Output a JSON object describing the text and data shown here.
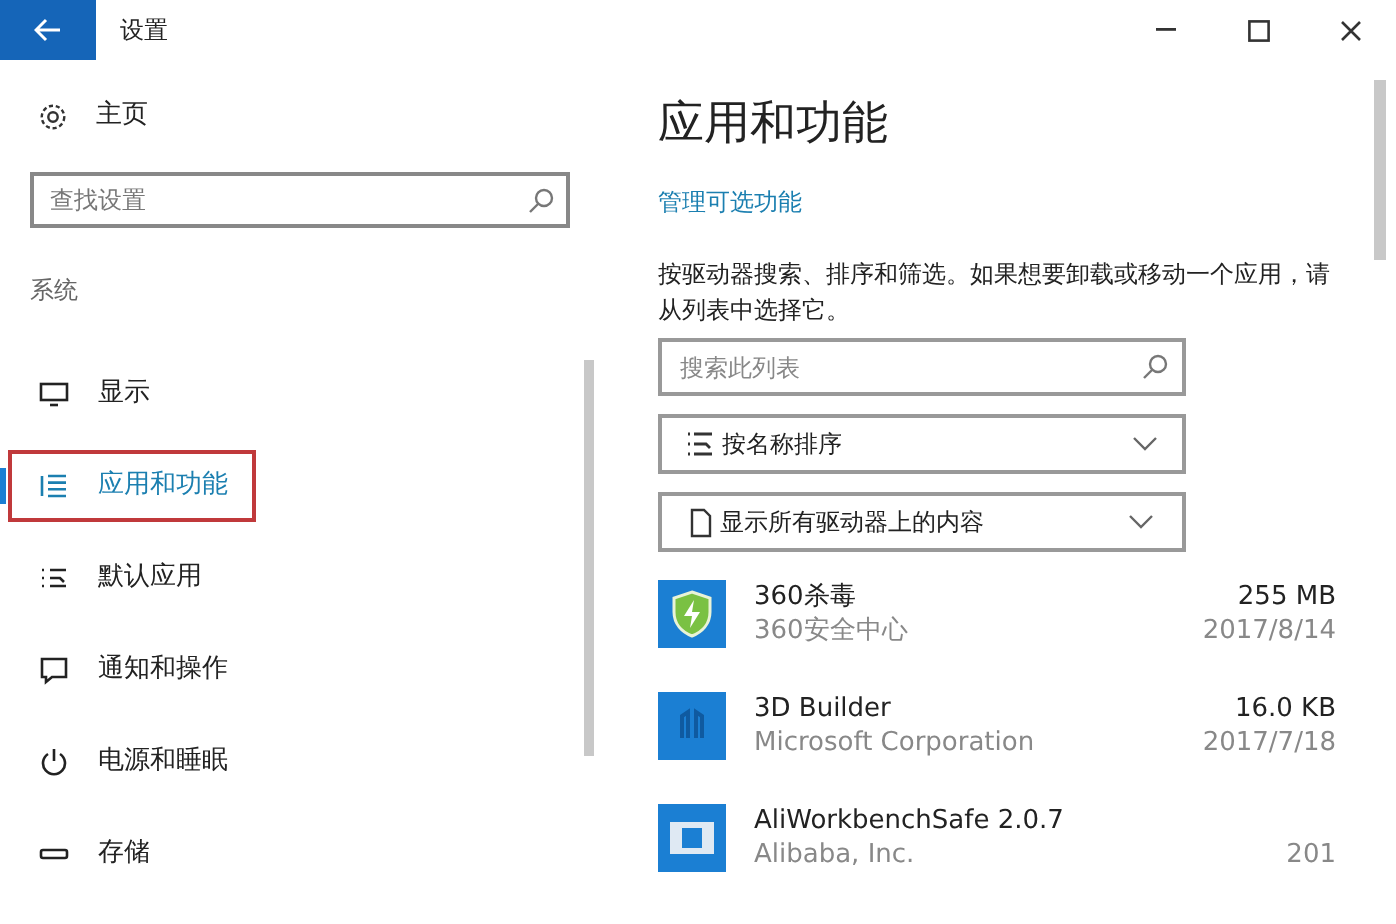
{
  "window": {
    "title": "设置"
  },
  "sidebar": {
    "home": "主页",
    "search": {
      "placeholder": "查找设置"
    },
    "section": "系统",
    "items": [
      {
        "label": "显示",
        "selected": false
      },
      {
        "label": "应用和功能",
        "selected": true
      },
      {
        "label": "默认应用",
        "selected": false
      },
      {
        "label": "通知和操作",
        "selected": false
      },
      {
        "label": "电源和睡眠",
        "selected": false
      },
      {
        "label": "存储",
        "selected": false
      }
    ]
  },
  "main": {
    "title": "应用和功能",
    "link": "管理可选功能",
    "description": "按驱动器搜索、排序和筛选。如果想要卸载或移动一个应用，请从列表中选择它。",
    "search": {
      "placeholder": "搜索此列表"
    },
    "sort": "按名称排序",
    "filter": "显示所有驱动器上的内容",
    "apps": [
      {
        "name": "360杀毒",
        "publisher": "360安全中心",
        "size": "255 MB",
        "date": "2017/8/14"
      },
      {
        "name": "3D Builder",
        "publisher": "Microsoft Corporation",
        "size": "16.0 KB",
        "date": "2017/7/18"
      },
      {
        "name": "AliWorkbenchSafe 2.0.7",
        "publisher": "Alibaba, Inc.",
        "date": "201"
      }
    ]
  }
}
